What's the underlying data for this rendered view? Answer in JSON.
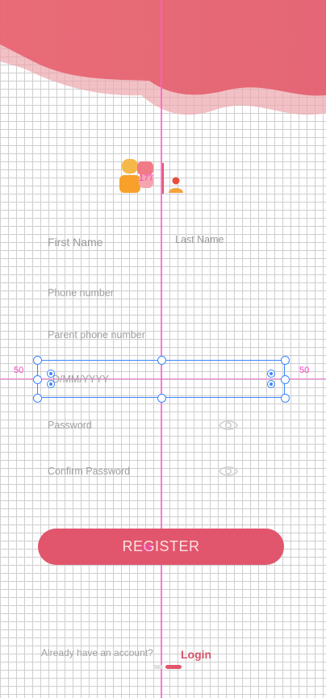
{
  "guides": {
    "left_value": "50",
    "right_value": "50",
    "badge_value": "177",
    "register_badge": "85"
  },
  "form": {
    "first_name_placeholder": "First Name",
    "last_name_placeholder": "Last Name",
    "phone_placeholder": "Phone number",
    "parent_phone_placeholder": "Parent phone number",
    "dob_placeholder": "D/MM/YYYY",
    "password_placeholder": "Password",
    "confirm_password_placeholder": "Confirm Password"
  },
  "register_label": "REGISTER",
  "footer": {
    "prompt": "Already have an account?",
    "login_label": "Login"
  },
  "colors": {
    "accent": "#e1566c",
    "guide": "#ff5ed0",
    "selection": "#3b86ff"
  },
  "icons": [
    "eye-icon",
    "logo-icon"
  ]
}
